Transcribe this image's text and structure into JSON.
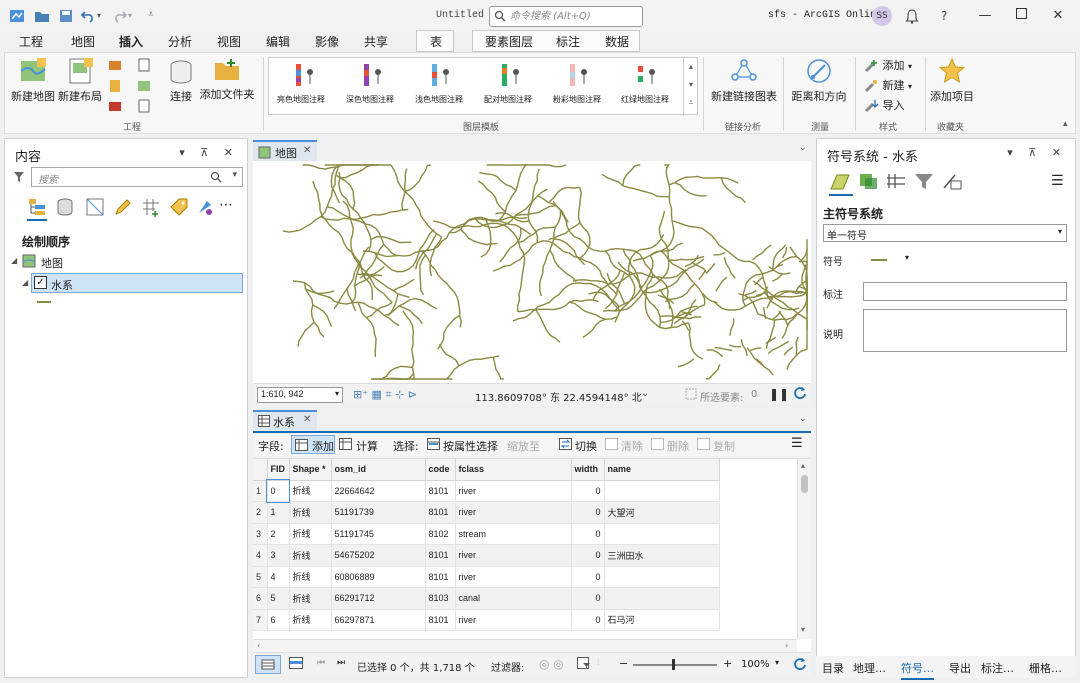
{
  "window": {
    "doc_title": "Untitled",
    "search_placeholder": "命令搜索 (Alt+Q)",
    "account": "sfs - ArcGIS Online",
    "avatar_initials": "SS",
    "help": "?"
  },
  "ribbon_tabs": [
    "工程",
    "地图",
    "插入",
    "分析",
    "视图",
    "编辑",
    "影像",
    "共享",
    "表",
    "要素图层",
    "标注",
    "数据"
  ],
  "active_tab": "插入",
  "ribbon": {
    "project_group": {
      "new_map": "新建地图",
      "new_layout": "新建布局",
      "connect": "连接",
      "add_folder": "添加文件夹",
      "label": "工程"
    },
    "layer_templates": {
      "items": [
        "亮色地图注释",
        "深色地图注释",
        "浅色地图注释",
        "配对地图注释",
        "粉彩地图注释",
        "红绿地图注释"
      ],
      "label": "图层模板"
    },
    "link_analysis": {
      "new_link_chart": "新建链接图表",
      "label": "链接分析"
    },
    "measure": {
      "distance_direction": "距离和方向",
      "label": "测量"
    },
    "styles": {
      "add": "添加",
      "new": "新建",
      "import": "导入",
      "label": "样式"
    },
    "favorites": {
      "add_item": "添加项目",
      "label": "收藏夹"
    }
  },
  "contents": {
    "title": "内容",
    "search_placeholder": "搜索",
    "drawing_order": "绘制顺序",
    "map_node": "地图",
    "layer_node": "水系"
  },
  "map": {
    "tab_label": "地图",
    "scale": "1:610, 942",
    "coords": "113.8609708° 东  22.4594148° 北",
    "selected_features": "所选要素:",
    "selected_count": "0",
    "line_color": "#8b8a42"
  },
  "attribute_table": {
    "tab_label": "水系",
    "toolbar": {
      "field_label": "字段:",
      "add": "添加",
      "calculate": "计算",
      "select_label": "选择:",
      "select_by_attr": "按属性选择",
      "zoom_to": "缩放至",
      "switch": "切换",
      "clear": "清除",
      "delete": "删除",
      "copy": "复制"
    },
    "columns": [
      "FID",
      "Shape *",
      "osm_id",
      "code",
      "fclass",
      "width",
      "name"
    ],
    "rows": [
      [
        "0",
        "折线",
        "22664642",
        "8101",
        "river",
        "0",
        ""
      ],
      [
        "1",
        "折线",
        "51191739",
        "8101",
        "river",
        "0",
        "大望河"
      ],
      [
        "2",
        "折线",
        "51191745",
        "8102",
        "stream",
        "0",
        ""
      ],
      [
        "3",
        "折线",
        "54675202",
        "8101",
        "river",
        "0",
        "三洲田水"
      ],
      [
        "4",
        "折线",
        "60806889",
        "8101",
        "river",
        "0",
        ""
      ],
      [
        "5",
        "折线",
        "66291712",
        "8103",
        "canal",
        "0",
        ""
      ],
      [
        "6",
        "折线",
        "66297871",
        "8101",
        "river",
        "0",
        "石马河"
      ]
    ],
    "footer": {
      "selection_info": "已选择 0 个，共 1,718 个",
      "filter_label": "过滤器:",
      "zoom": "100%"
    }
  },
  "symbology": {
    "title": "符号系统 - 水系",
    "primary_label": "主符号系统",
    "primary_value": "单一符号",
    "symbol_label": "符号",
    "label_label": "标注",
    "desc_label": "说明"
  },
  "bottom_tabs": [
    "目录",
    "地理…",
    "符号…",
    "导出",
    "标注…",
    "栅格…"
  ],
  "bottom_active": "符号…",
  "colors": {
    "accent": "#1a6bb5",
    "selection": "#cfe3f7"
  }
}
